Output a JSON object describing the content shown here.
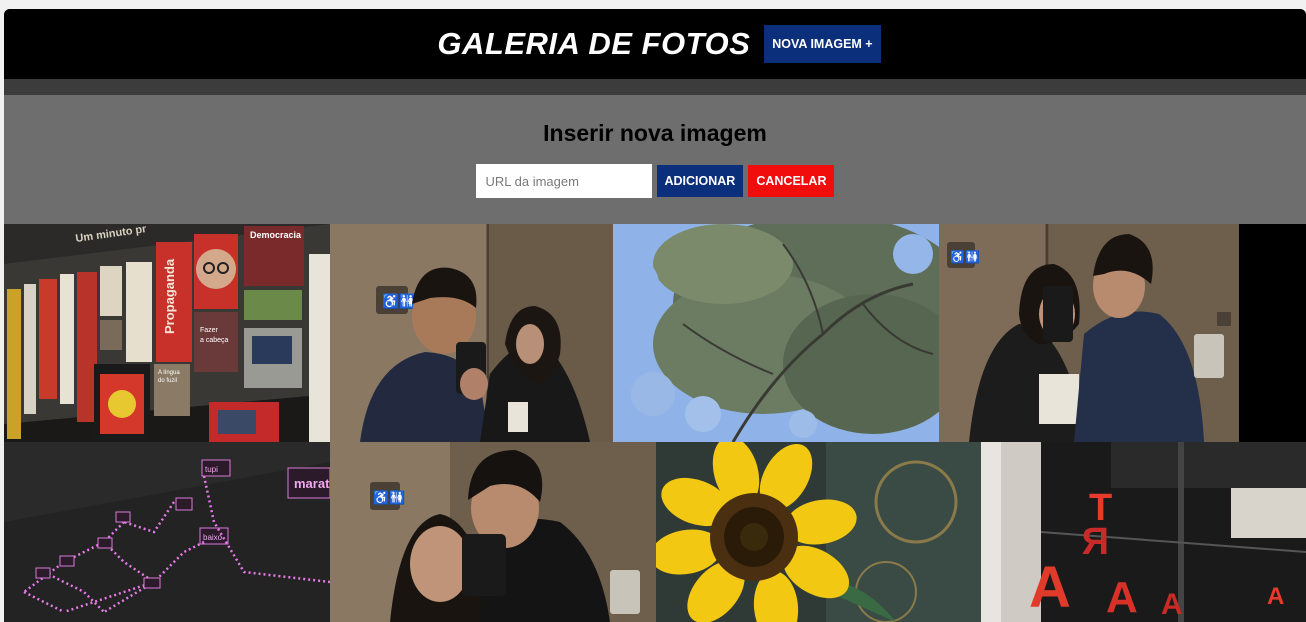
{
  "header": {
    "title": "GALERIA DE FOTOS",
    "new_image_label": "NOVA IMAGEM +"
  },
  "form": {
    "title": "Inserir nova imagem",
    "url_placeholder": "URL da imagem",
    "url_value": "",
    "add_label": "ADICIONAR",
    "cancel_label": "CANCELAR"
  },
  "gallery": {
    "photos": [
      {
        "subject": "museum exhibit wall",
        "labels": [
          "Um minuto pr",
          "Democracia",
          "Propaganda",
          "Fazer a cabeça",
          "A língua do fuzil"
        ]
      },
      {
        "subject": "couple selfie in restroom mirror"
      },
      {
        "subject": "tree canopy against blue sky"
      },
      {
        "subject": "couple kissing in mirror selfie"
      },
      {
        "subject": "neon network diagram wall",
        "labels": [
          "marati",
          "tupi",
          "baixo"
        ]
      },
      {
        "subject": "couple hugging mirror selfie"
      },
      {
        "subject": "sunflower close-up"
      },
      {
        "subject": "red letter sculptures"
      }
    ]
  },
  "colors": {
    "header_bg": "#000000",
    "panel_bg": "#6e6e6e",
    "primary_button": "#0b2f7a",
    "cancel_button": "#f20d0d"
  }
}
